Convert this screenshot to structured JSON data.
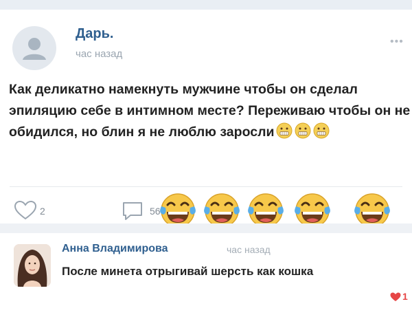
{
  "post": {
    "author": "Дарь.",
    "time": "час назад",
    "text": "Как деликатно намекнуть мужчине чтобы он сделал эпиляцию себе в интимном месте? Переживаю чтобы он не обидился, но блин я не люблю заросли",
    "inline_emoji": [
      "grimacing-face-icon",
      "grimacing-face-icon",
      "grimacing-face-icon"
    ],
    "likes": "2",
    "comments": "56",
    "reaction_emoji": [
      "face-with-tears-of-joy-icon",
      "face-with-tears-of-joy-icon",
      "face-with-tears-of-joy-icon",
      "face-with-tears-of-joy-icon",
      "face-with-tears-of-joy-icon"
    ],
    "more_icon": "more-dots-icon"
  },
  "comment": {
    "author": "Анна Владимирова",
    "time": "час назад",
    "text": "После минета отрыгивай шерсть как кошка",
    "likes": "1"
  },
  "colors": {
    "name": "#2f5f8f",
    "muted": "#9aa5b0",
    "heart": "#e64646",
    "emoji_yellow": "#f7c84a"
  }
}
